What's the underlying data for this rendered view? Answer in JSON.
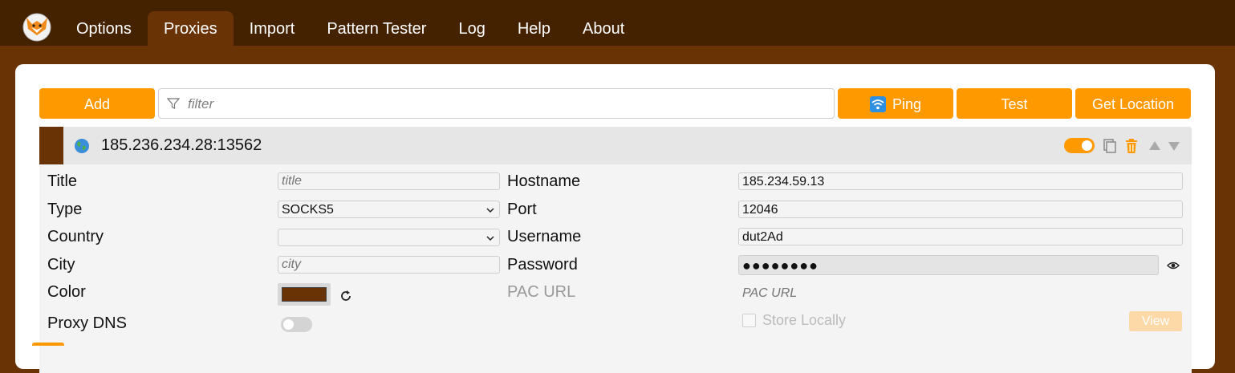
{
  "nav": {
    "tabs": [
      {
        "label": "Options"
      },
      {
        "label": "Proxies"
      },
      {
        "label": "Import"
      },
      {
        "label": "Pattern Tester"
      },
      {
        "label": "Log"
      },
      {
        "label": "Help"
      },
      {
        "label": "About"
      }
    ],
    "active": "Proxies"
  },
  "toolbar": {
    "add_label": "Add",
    "filter_placeholder": "filter",
    "ping_label": "Ping",
    "test_label": "Test",
    "get_location_label": "Get Location"
  },
  "proxy": {
    "header_title": "185.236.234.28:13562",
    "enabled": true,
    "color": "#6a3306",
    "labels": {
      "title": "Title",
      "type": "Type",
      "country": "Country",
      "city": "City",
      "color": "Color",
      "proxy_dns": "Proxy DNS",
      "hostname": "Hostname",
      "port": "Port",
      "username": "Username",
      "password": "Password",
      "pac_url": "PAC URL",
      "store_locally": "Store Locally",
      "view": "View"
    },
    "placeholders": {
      "title": "title",
      "city": "city",
      "pac_url": "PAC URL"
    },
    "values": {
      "type": "SOCKS5",
      "country": "",
      "hostname": "185.234.59.13",
      "port": "12046",
      "username": "dut2Ad",
      "password_masked": "●●●●●●●●"
    },
    "proxy_dns_enabled": false,
    "store_locally_checked": false
  },
  "colors": {
    "accent": "#ff9900",
    "nav_bg": "#442200",
    "page_bg": "#6a3306"
  }
}
